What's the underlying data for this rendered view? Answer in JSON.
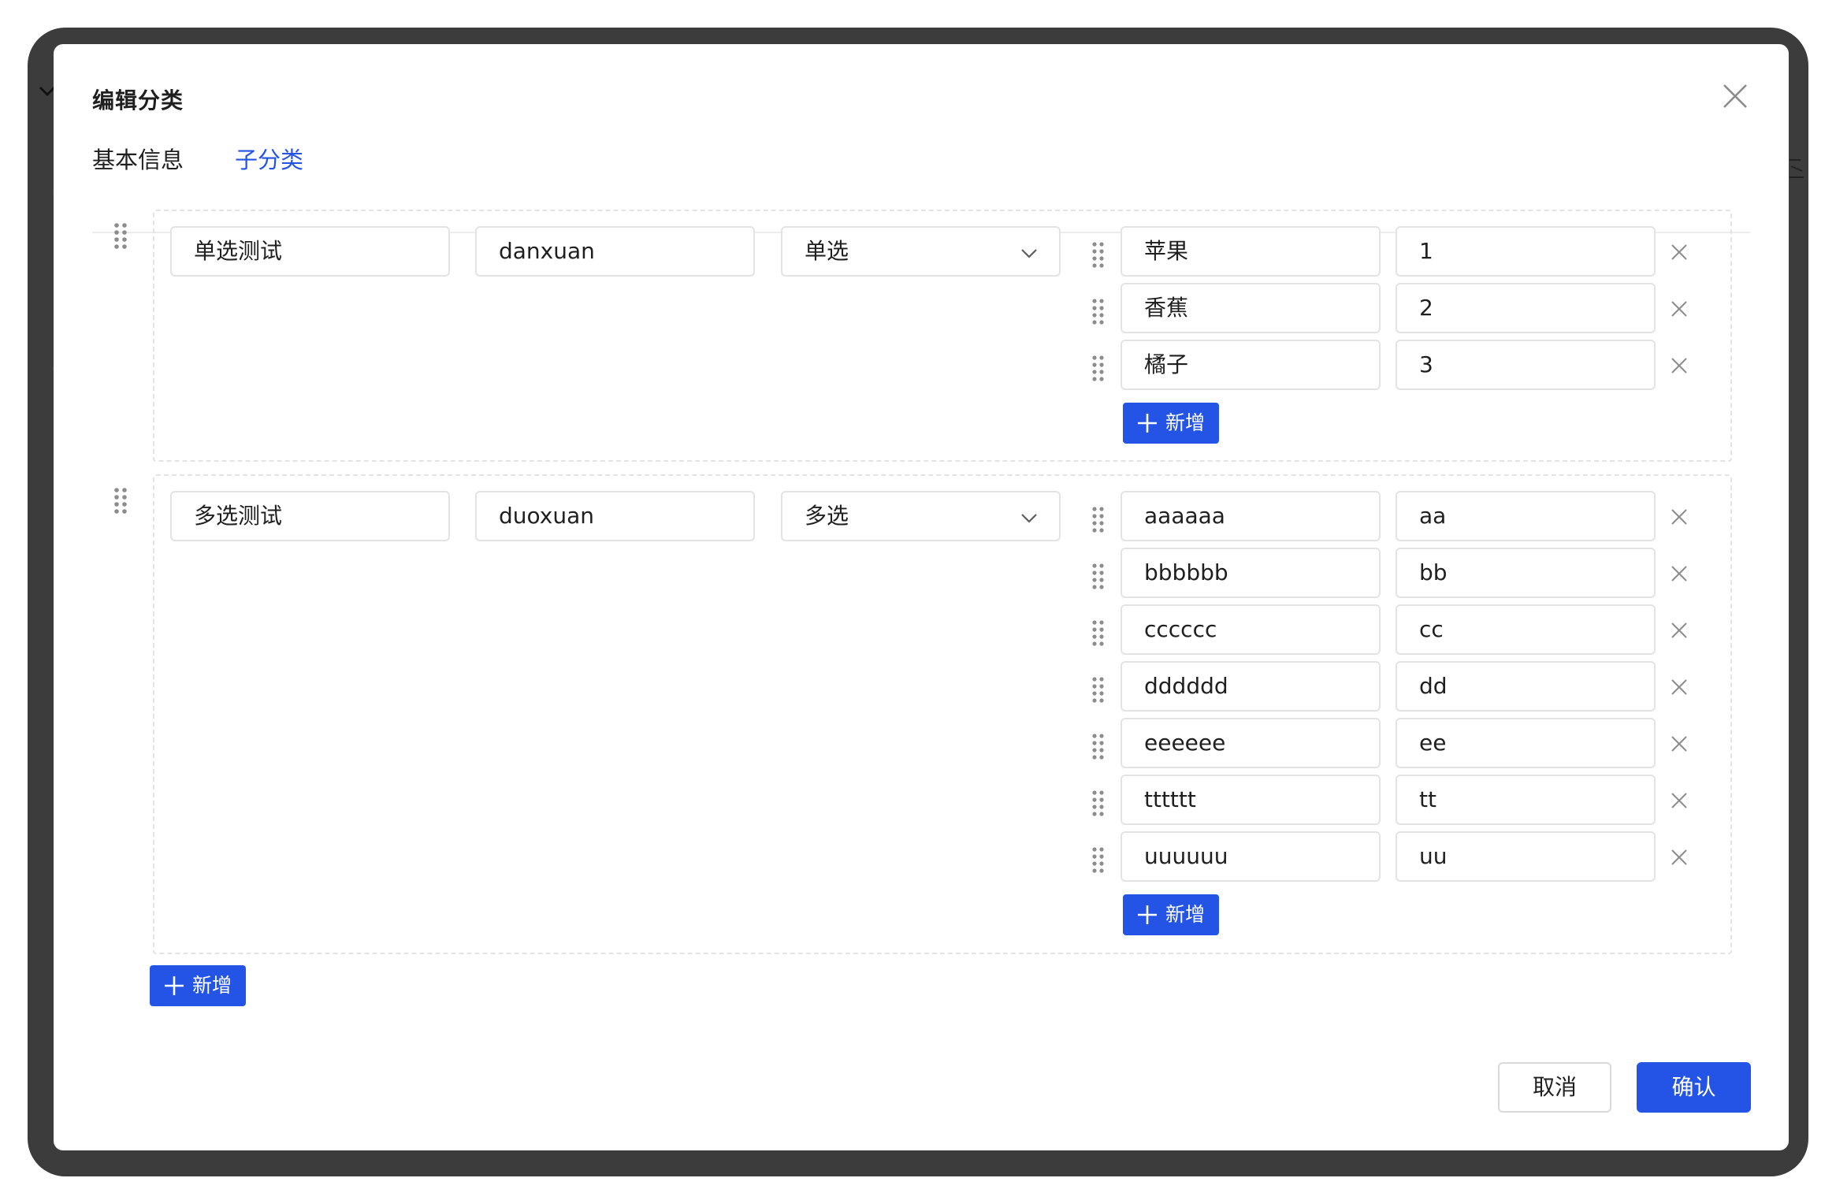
{
  "modal": {
    "title": "编辑分类"
  },
  "tabs": [
    {
      "label": "基本信息",
      "active": false
    },
    {
      "label": "子分类",
      "active": true
    }
  ],
  "groups": [
    {
      "name": "单选测试",
      "code": "danxuan",
      "type": "单选",
      "options": [
        {
          "label": "苹果",
          "value": "1"
        },
        {
          "label": "香蕉",
          "value": "2"
        },
        {
          "label": "橘子",
          "value": "3"
        }
      ],
      "add_option_label": "新增"
    },
    {
      "name": "多选测试",
      "code": "duoxuan",
      "type": "多选",
      "options": [
        {
          "label": "aaaaaa",
          "value": "aa"
        },
        {
          "label": "bbbbbb",
          "value": "bb"
        },
        {
          "label": "cccccc",
          "value": "cc"
        },
        {
          "label": "dddddd",
          "value": "dd"
        },
        {
          "label": "eeeeee",
          "value": "ee"
        },
        {
          "label": "tttttt",
          "value": "tt"
        },
        {
          "label": "uuuuuu",
          "value": "uu"
        }
      ],
      "add_option_label": "新增"
    }
  ],
  "add_group_label": "新增",
  "footer": {
    "cancel_label": "取消",
    "confirm_label": "确认"
  },
  "colors": {
    "primary": "#2454e6",
    "border": "#e3e3e3",
    "frame": "#3c3c3c"
  },
  "icons": {
    "close": "close-icon",
    "drag": "drag-handle-icon",
    "chevron": "chevron-down-icon",
    "plus": "plus-icon",
    "remove": "remove-row-icon"
  }
}
